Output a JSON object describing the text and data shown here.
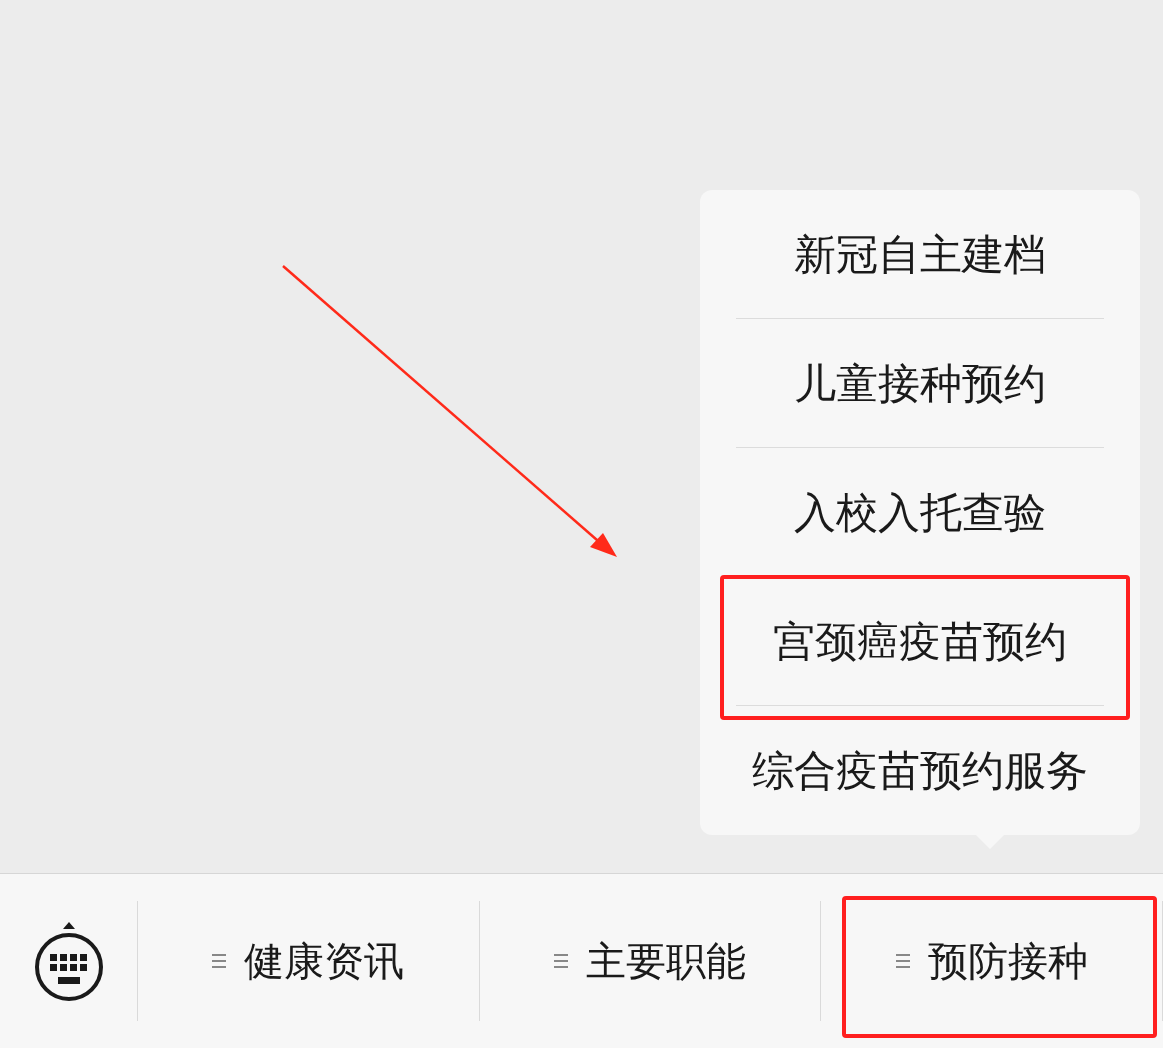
{
  "popup_menu": {
    "items": [
      {
        "label": "新冠自主建档",
        "highlighted": false
      },
      {
        "label": "儿童接种预约",
        "highlighted": false
      },
      {
        "label": "入校入托查验",
        "highlighted": false
      },
      {
        "label": "宫颈癌疫苗预约",
        "highlighted": true
      },
      {
        "label": "综合疫苗预约服务",
        "highlighted": false
      }
    ]
  },
  "annotation_arrow": true,
  "menu_bar": {
    "tabs": [
      {
        "label": "健康资讯",
        "highlighted": false
      },
      {
        "label": "主要职能",
        "highlighted": false
      },
      {
        "label": "预防接种",
        "highlighted": true
      }
    ]
  }
}
